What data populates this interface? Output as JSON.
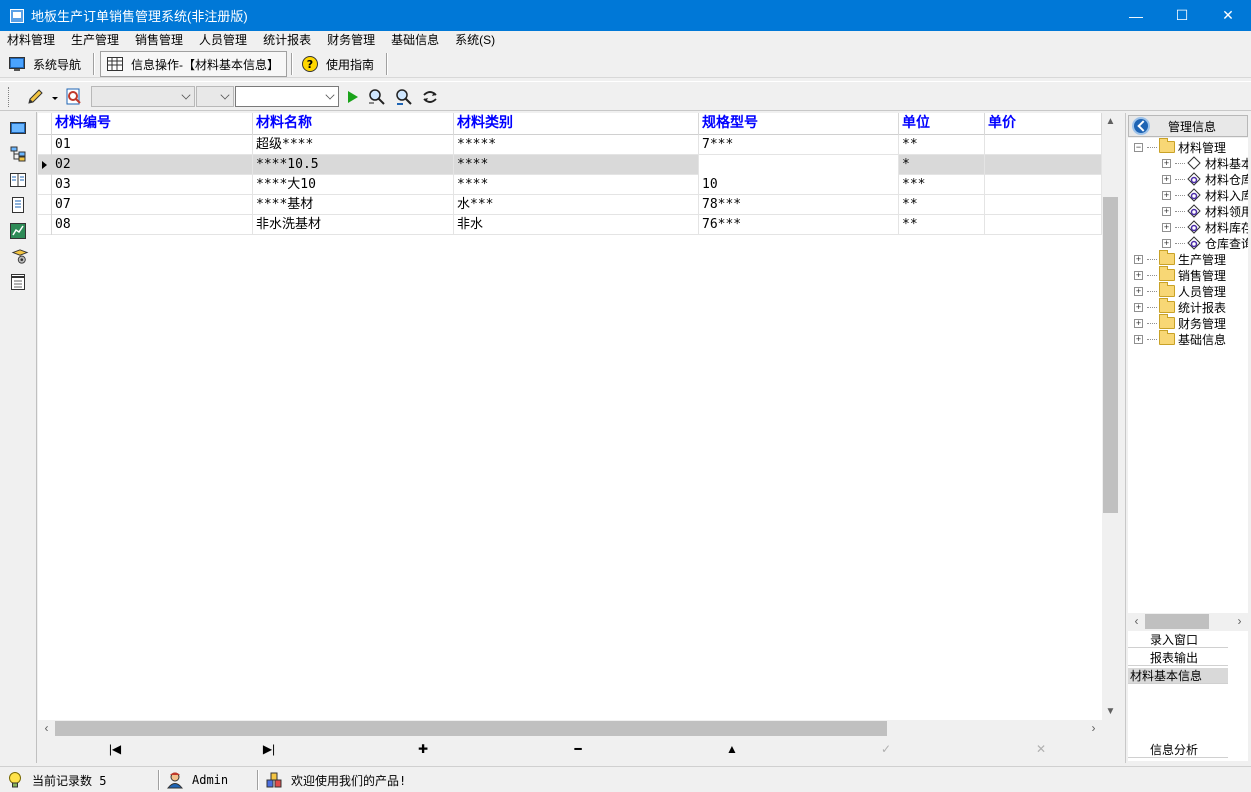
{
  "window": {
    "title": "地板生产订单销售管理系统(非注册版)",
    "controls": {
      "minimize": "—",
      "maximize": "☐",
      "close": "✕"
    }
  },
  "menu": [
    "材料管理",
    "生产管理",
    "销售管理",
    "人员管理",
    "统计报表",
    "财务管理",
    "基础信息",
    "系统(S)"
  ],
  "nav_tabs": {
    "system_nav": "系统导航",
    "info_op": "信息操作-【材料基本信息】",
    "guide": "使用指南"
  },
  "toolbar": {
    "combo1_value": "",
    "combo2_value": "",
    "combo3_value": ""
  },
  "grid": {
    "columns": [
      "材料编号",
      "材料名称",
      "材料类别",
      "规格型号",
      "单位",
      "单价"
    ],
    "rows": [
      [
        "01",
        "超级****",
        "*****",
        "7***",
        "**",
        ""
      ],
      [
        "02",
        "****10.5",
        "****",
        "",
        "*",
        ""
      ],
      [
        "03",
        "****大10",
        "****",
        "10",
        "***",
        ""
      ],
      [
        "07",
        "****基材",
        "水***",
        "78***",
        "**",
        ""
      ],
      [
        "08",
        "非水洗基材",
        "非水",
        "76***",
        "**",
        ""
      ]
    ],
    "selected_row": 1
  },
  "navigator": {
    "first": "|◀",
    "last": "▶|",
    "add": "✚",
    "delete": "━",
    "up": "▲",
    "post": "✓",
    "cancel": "✕"
  },
  "right_panel": {
    "header": "管理信息",
    "tree": {
      "root": "材料管理",
      "children": [
        "材料基本信息",
        "材料仓库",
        "材料入库",
        "材料领用",
        "材料库存",
        "仓库查询"
      ],
      "siblings": [
        "生产管理",
        "销售管理",
        "人员管理",
        "统计报表",
        "财务管理",
        "基础信息"
      ]
    },
    "panel_items": [
      "录入窗口",
      "报表输出",
      "材料基本信息"
    ],
    "analysis": "信息分析"
  },
  "status": {
    "record_count": "当前记录数 5",
    "user": "Admin",
    "welcome": "欢迎使用我们的产品!"
  },
  "colors": {
    "titlebar": "#0078d7",
    "header_text": "#0000ff",
    "selected_row": "#d9d9d9"
  }
}
